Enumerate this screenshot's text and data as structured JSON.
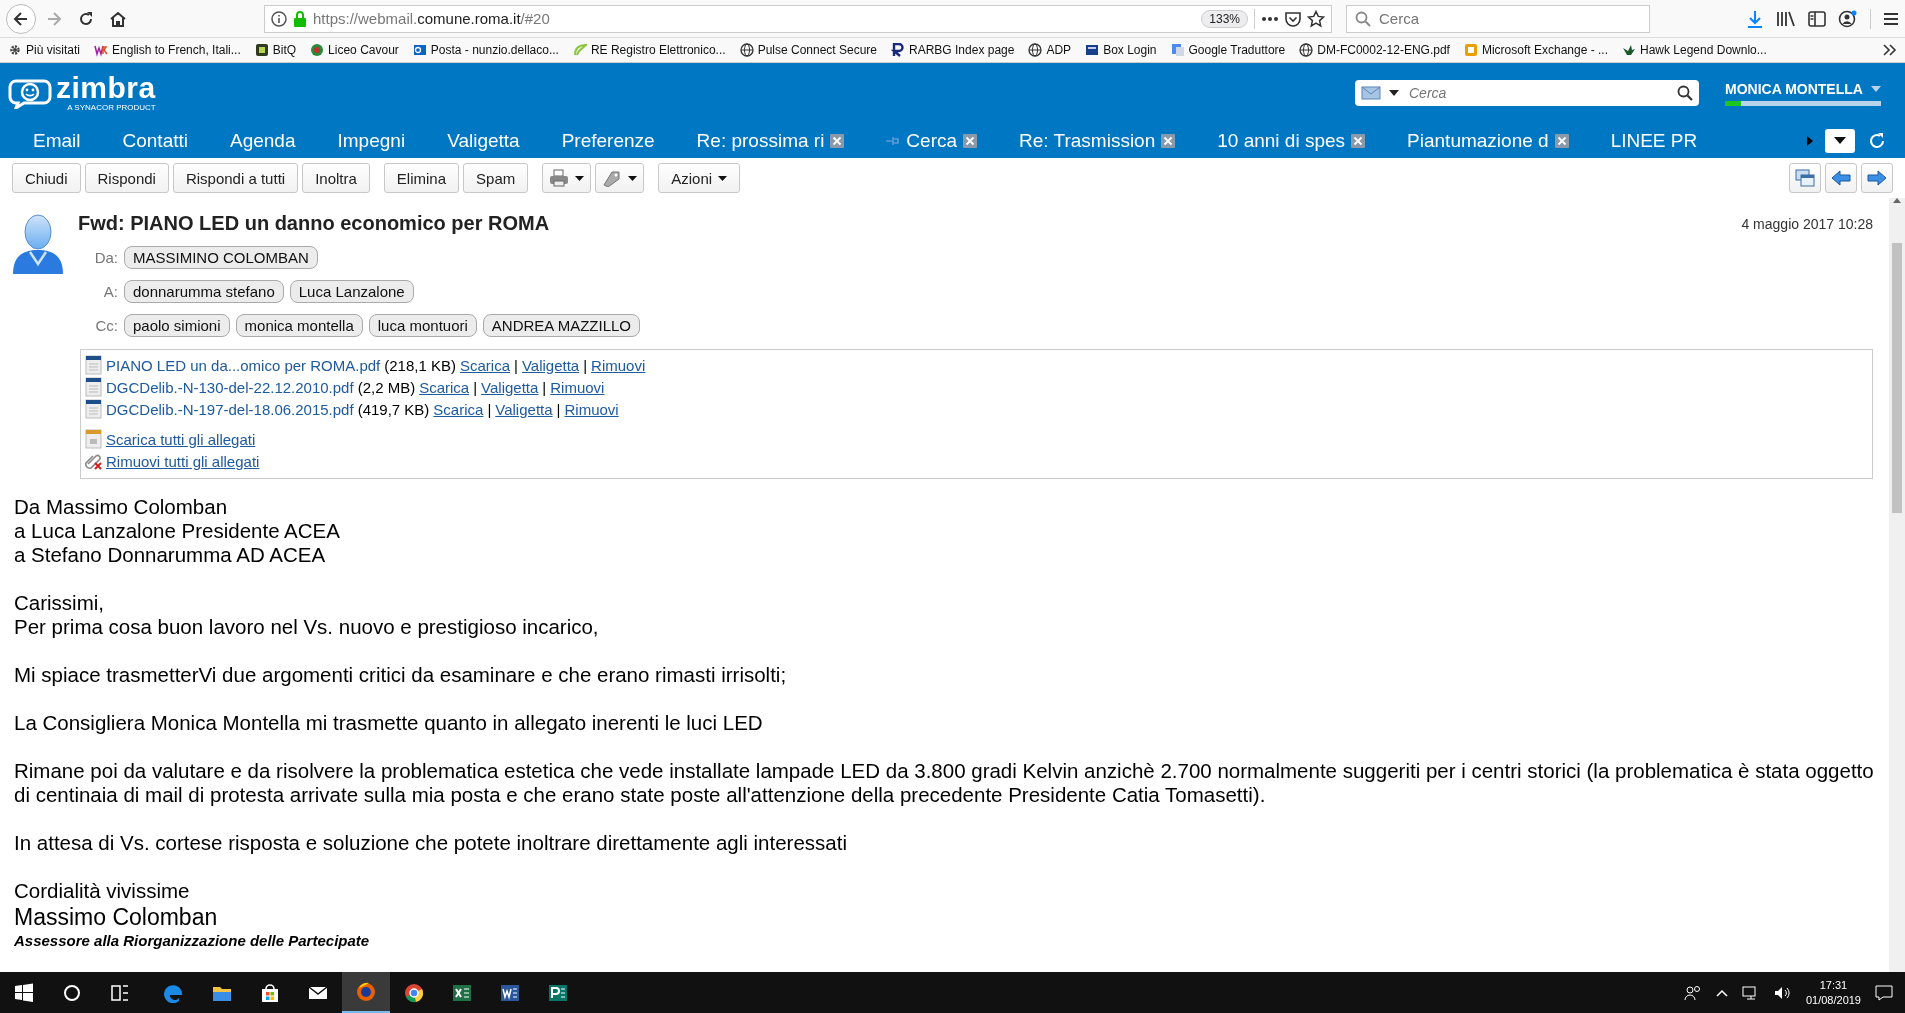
{
  "browser": {
    "url_prefix": "https://webmail.",
    "url_domain": "comune.roma.it",
    "url_suffix": "/#20",
    "zoom": "133%",
    "search_placeholder": "Cerca",
    "bookmarks": [
      {
        "label": "Più visitati"
      },
      {
        "label": "English to French, Itali..."
      },
      {
        "label": "BitQ"
      },
      {
        "label": "Liceo Cavour"
      },
      {
        "label": "Posta - nunzio.dellaco..."
      },
      {
        "label": "RE Registro Elettronico..."
      },
      {
        "label": "Pulse Connect Secure"
      },
      {
        "label": "RARBG Index page"
      },
      {
        "label": "ADP"
      },
      {
        "label": "Box Login"
      },
      {
        "label": "Google Traduttore"
      },
      {
        "label": "DM-FC0002-12-ENG.pdf"
      },
      {
        "label": "Microsoft Exchange - ..."
      },
      {
        "label": "Hawk Legend Downlo..."
      }
    ]
  },
  "app": {
    "logo": "zimbra",
    "logo_sub": "A SYNACOR PRODUCT",
    "search_placeholder": "Cerca",
    "user": "MONICA MONTELLA",
    "quota": {
      "level": 0.1
    },
    "tabs": [
      {
        "label": "Email",
        "kind": "app",
        "selected": false
      },
      {
        "label": "Contatti",
        "kind": "app",
        "selected": false
      },
      {
        "label": "Agenda",
        "kind": "app",
        "selected": false
      },
      {
        "label": "Impegni",
        "kind": "app",
        "selected": false
      },
      {
        "label": "Valigetta",
        "kind": "app",
        "selected": false
      },
      {
        "label": "Preferenze",
        "kind": "app",
        "selected": false
      },
      {
        "label": "Re: prossima ri",
        "kind": "view",
        "selected": false
      },
      {
        "label": "Cerca",
        "kind": "search",
        "selected": false
      },
      {
        "label": "Re: Trasmission",
        "kind": "view",
        "selected": false
      },
      {
        "label": "10 anni di spes",
        "kind": "view",
        "selected": false
      },
      {
        "label": "Piantumazione d",
        "kind": "view",
        "selected": false
      },
      {
        "label": "LINEE PR",
        "kind": "cut",
        "selected": false
      }
    ]
  },
  "toolbar": [
    {
      "label": "Chiudi",
      "kind": "text"
    },
    {
      "label": "Rispondi",
      "kind": "text"
    },
    {
      "label": "Rispondi a tutti",
      "kind": "text"
    },
    {
      "label": "Inoltra",
      "kind": "text"
    },
    {
      "label": "Elimina",
      "kind": "text"
    },
    {
      "label": "Spam",
      "kind": "text"
    },
    {
      "kind": "print"
    },
    {
      "kind": "tag"
    },
    {
      "label": "Azioni",
      "kind": "menu"
    }
  ],
  "message": {
    "subject": "Fwd: PIANO LED un danno economico per ROMA",
    "date": "4 maggio 2017 10:28",
    "fields": [
      {
        "label": "Da:",
        "people": [
          "MASSIMINO COLOMBAN"
        ]
      },
      {
        "label": "A:",
        "people": [
          "donnarumma stefano",
          "Luca Lanzalone"
        ]
      },
      {
        "label": "Cc:",
        "people": [
          "paolo simioni",
          "monica montella",
          "luca montuori",
          "ANDREA MAZZILLO"
        ]
      }
    ],
    "attachments": [
      {
        "name": "PIANO LED un da...omico per ROMA.pdf",
        "size": "(218,1 KB)",
        "actions": [
          {
            "kind": "link",
            "text": "Scarica"
          },
          {
            "kind": "sep",
            "text": "|"
          },
          {
            "kind": "link",
            "text": "Valigetta"
          },
          {
            "kind": "sep",
            "text": "|"
          },
          {
            "kind": "link",
            "text": "Rimuovi"
          }
        ]
      },
      {
        "name": "DGCDelib.-N-130-del-22.12.2010.pdf",
        "size": "(2,2 MB)",
        "actions": [
          {
            "kind": "link",
            "text": "Scarica"
          },
          {
            "kind": "sep",
            "text": "|"
          },
          {
            "kind": "link",
            "text": "Valigetta"
          },
          {
            "kind": "sep",
            "text": "|"
          },
          {
            "kind": "link",
            "text": "Rimuovi"
          }
        ]
      },
      {
        "name": "DGCDelib.-N-197-del-18.06.2015.pdf",
        "size": "(419,7 KB)",
        "actions": [
          {
            "kind": "link",
            "text": "Scarica"
          },
          {
            "kind": "sep",
            "text": "|"
          },
          {
            "kind": "link",
            "text": "Valigetta"
          },
          {
            "kind": "sep",
            "text": "|"
          },
          {
            "kind": "link",
            "text": "Rimuovi"
          }
        ]
      }
    ],
    "bulk_actions": [
      {
        "label": "Scarica tutti gli allegati",
        "kind": "download"
      },
      {
        "label": "Rimuovi tutti gli allegati",
        "kind": "remove"
      }
    ],
    "body": [
      {
        "lines": [
          {
            "kind": "plain",
            "text": "Da Massimo Colomban"
          },
          {
            "kind": "plain",
            "text": "a Luca Lanzalone Presidente ACEA"
          },
          {
            "kind": "plain",
            "text": "a Stefano Donnarumma AD ACEA"
          }
        ]
      },
      {
        "lines": [
          {
            "kind": "plain",
            "text": "Carissimi,"
          },
          {
            "kind": "plain",
            "text": "Per prima cosa buon lavoro nel Vs. nuovo e prestigioso incarico,"
          }
        ]
      },
      {
        "lines": [
          {
            "kind": "plain",
            "text": "Mi spiace trasmetterVi due argomenti critici da esaminare e che erano rimasti irrisolti;"
          }
        ]
      },
      {
        "lines": [
          {
            "kind": "plain",
            "text": "La Consigliera Monica Montella mi trasmette quanto in allegato inerenti le luci LED"
          }
        ]
      },
      {
        "lines": [
          {
            "kind": "plain",
            "text": "Rimane poi da valutare e da risolvere la problematica estetica che vede installate lampade LED da 3.800 gradi Kelvin anzichè 2.700 normalmente suggeriti per i centri storici (la problematica è stata oggetto di centinaia di mail di protesta arrivate sulla mia posta e che erano state poste all'attenzione della precedente Presidente Catia Tomasetti)."
          }
        ]
      },
      {
        "lines": [
          {
            "kind": "plain",
            "text": "In attesa di Vs. cortese risposta e soluzione che potete inoltrare direttamente agli interessati"
          }
        ]
      },
      {
        "lines": [
          {
            "kind": "plain",
            "text": "Cordialità vivissime"
          },
          {
            "kind": "name",
            "text": "Massimo Colomban"
          },
          {
            "kind": "role",
            "text": "Assessore alla Riorganizzazione delle Partecipate"
          }
        ]
      }
    ]
  },
  "taskbar": {
    "apps": [
      {
        "kind": "edge",
        "selected": false
      },
      {
        "kind": "explorer",
        "selected": false
      },
      {
        "kind": "store",
        "selected": false
      },
      {
        "kind": "mail",
        "selected": false
      },
      {
        "kind": "firefox",
        "selected": true
      },
      {
        "kind": "chrome",
        "selected": false
      },
      {
        "kind": "excel",
        "selected": false
      },
      {
        "kind": "word",
        "selected": false
      },
      {
        "kind": "publisher",
        "selected": false
      }
    ],
    "time": "17:31",
    "date": "01/08/2019"
  }
}
